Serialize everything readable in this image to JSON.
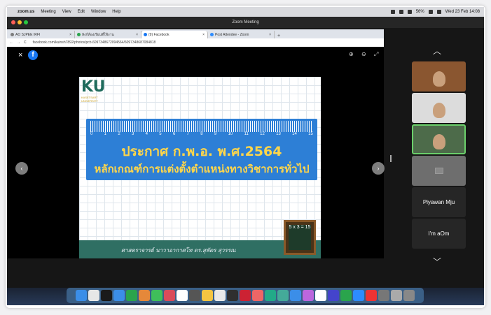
{
  "menubar": {
    "app": "zoom.us",
    "items": [
      "Meeting",
      "View",
      "Edit",
      "Window",
      "Help"
    ],
    "clock": "Wed 23 Feb 14:08",
    "battery": "56%"
  },
  "window": {
    "title": "Zoom Meeting"
  },
  "browser": {
    "tabs": [
      {
        "label": "AO SJPEE IRFI",
        "color": "#7d7d7d"
      },
      {
        "label": "ลิงก์ห้องเรียนที่ใช้งาน",
        "color": "#2aa44c"
      },
      {
        "label": "(9) Facebook",
        "color": "#1877f2"
      },
      {
        "label": "Post Attendee - Zoom",
        "color": "#2d8cff"
      }
    ],
    "url": "facebook.com/kuinsh7892/photos/pcb.6097348672094564/6097348687084818"
  },
  "slide": {
    "logo": "KU",
    "logo_sub": "KASETSART UNIVERSITY",
    "ruler_numbers": [
      "0",
      "1",
      "2",
      "3",
      "4",
      "5",
      "6",
      "7",
      "8",
      "9",
      "10",
      "11",
      "12",
      "13",
      "14",
      "15"
    ],
    "title_line1": "ประกาศ ก.พ.อ. พ.ศ.2564",
    "title_line2": "หลักเกณฑ์การแต่งตั้งตำแหน่งทางวิชาการทั่วไป",
    "footer": "ศาสตราจารย์ นาวาอากาศโท ดร.สุพัตร สุวรรณ",
    "board_text": "5 x 3 = 15"
  },
  "participants": [
    {
      "name": "",
      "type": "video",
      "color": "#8a5630"
    },
    {
      "name": "",
      "type": "video",
      "color": "#dcdcdc"
    },
    {
      "name": "",
      "type": "video",
      "color": "#4d6b4a"
    },
    {
      "name": "",
      "type": "off",
      "color": "#6e6e6e"
    },
    {
      "name": "Piyawan Mju",
      "type": "name",
      "color": "#262626"
    },
    {
      "name": "I'm aOm",
      "type": "name",
      "color": "#262626"
    }
  ],
  "accent": "#2d7fd6"
}
